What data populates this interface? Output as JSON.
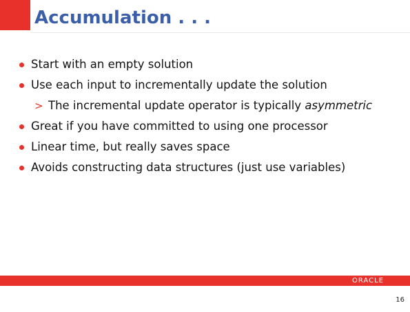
{
  "slide": {
    "title": "Accumulation . . .",
    "bullets": [
      {
        "text": "Start with an empty solution"
      },
      {
        "text": "Use each input to incrementally update the solution"
      },
      {
        "sub_marker": ">",
        "text": "The incremental update operator is typically ",
        "emphasis": "asymmetric"
      },
      {
        "text": "Great if you have committed to using one processor"
      },
      {
        "text": "Linear time, but really saves space"
      },
      {
        "text": "Avoids constructing data structures (just use variables)"
      }
    ],
    "footer": {
      "logo_text": "ORACLE",
      "page_number": "16"
    }
  },
  "colors": {
    "accent_red": "#e8312a",
    "title_blue": "#3b5ea8",
    "body_text": "#111111"
  }
}
